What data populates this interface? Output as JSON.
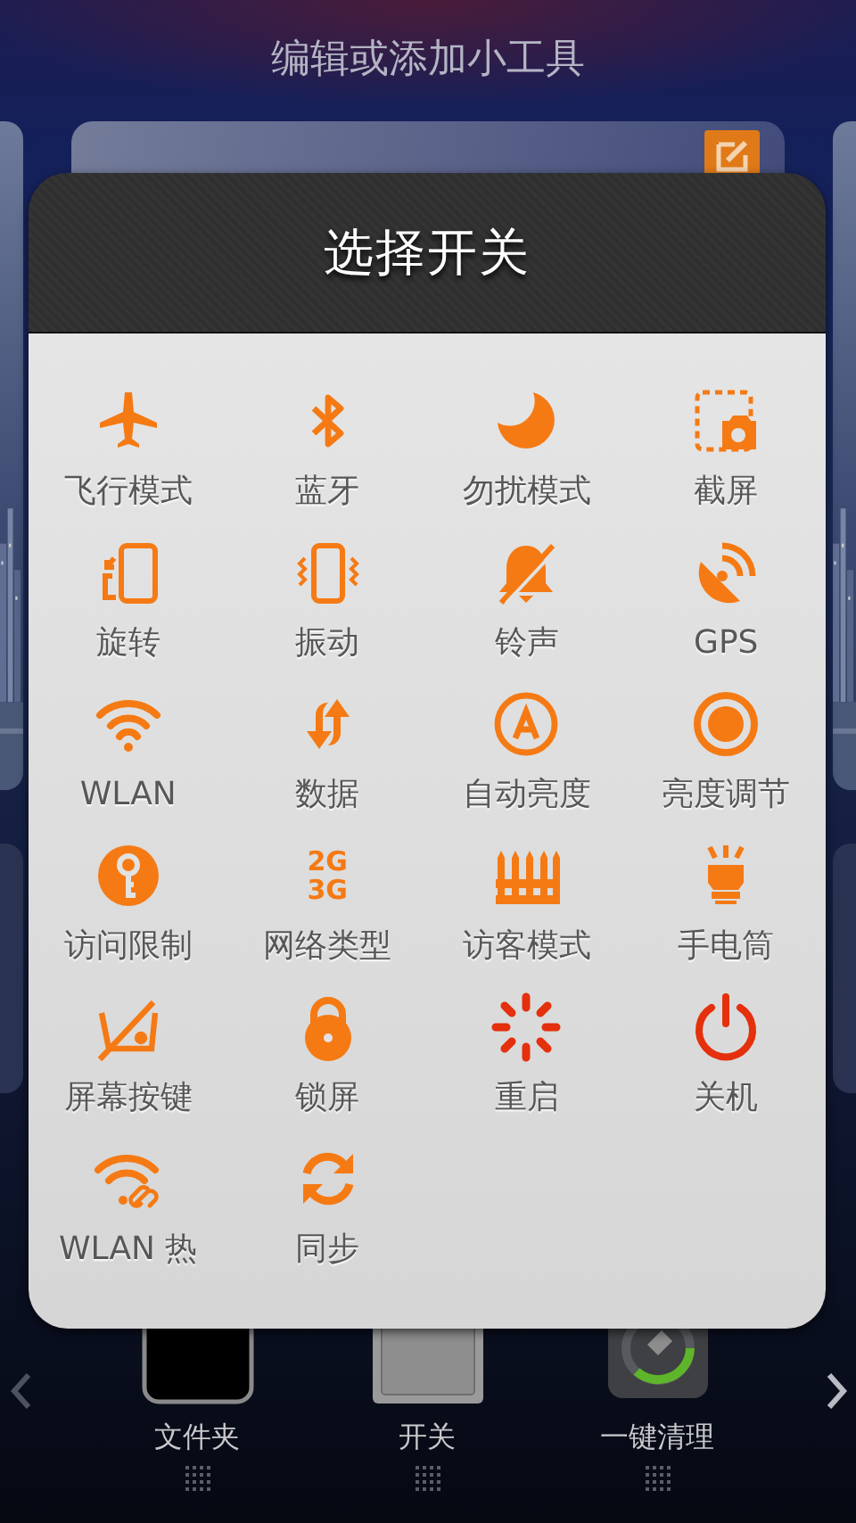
{
  "header": {
    "title": "编辑或添加小工具"
  },
  "dialog": {
    "title": "选择开关",
    "items": [
      {
        "label": "飞行模式",
        "kind": "icon"
      },
      {
        "label": "蓝牙",
        "kind": "icon"
      },
      {
        "label": "勿扰模式",
        "kind": "icon"
      },
      {
        "label": "截屏",
        "kind": "icon"
      },
      {
        "label": "旋转",
        "kind": "icon"
      },
      {
        "label": "振动",
        "kind": "icon"
      },
      {
        "label": "铃声",
        "kind": "icon"
      },
      {
        "label": "GPS",
        "kind": "icon"
      },
      {
        "label": "WLAN",
        "kind": "icon"
      },
      {
        "label": "数据",
        "kind": "icon"
      },
      {
        "label": "自动亮度",
        "kind": "icon"
      },
      {
        "label": "亮度调节",
        "kind": "icon"
      },
      {
        "label": "访问限制",
        "kind": "icon"
      },
      {
        "label": "网络类型",
        "kind": "text_icon"
      },
      {
        "label": "访客模式",
        "kind": "icon"
      },
      {
        "label": "手电筒",
        "kind": "icon"
      },
      {
        "label": "屏幕按键",
        "kind": "icon"
      },
      {
        "label": "锁屏",
        "kind": "icon"
      },
      {
        "label": "重启",
        "kind": "icon"
      },
      {
        "label": "关机",
        "kind": "icon"
      },
      {
        "label": "WLAN 热",
        "kind": "icon"
      },
      {
        "label": "同步",
        "kind": "icon"
      }
    ],
    "network_type_icon": [
      "2G",
      "3G"
    ]
  },
  "widgets": [
    {
      "label": "文件夹"
    },
    {
      "label": "开关"
    },
    {
      "label": "一键清理"
    }
  ]
}
